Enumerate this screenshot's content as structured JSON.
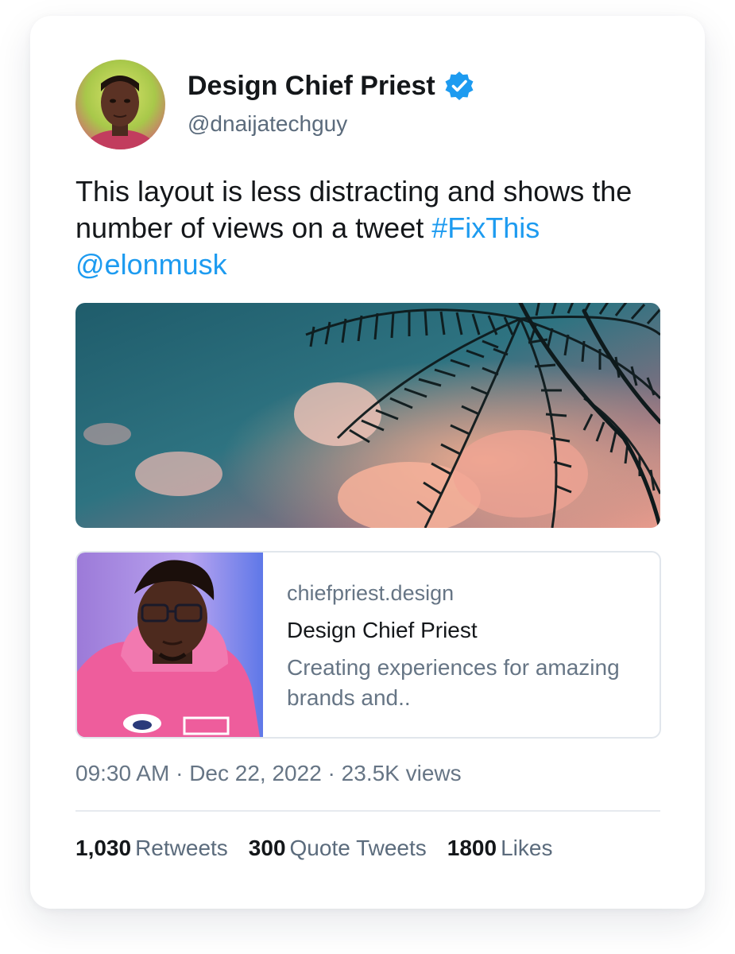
{
  "tweet": {
    "author": {
      "display_name": "Design Chief Priest",
      "handle": "@dnaijatechguy",
      "verified_icon": "verified-badge-icon",
      "avatar": "author-avatar"
    },
    "text": {
      "body": "This layout is less distracting and shows the number of views on a tweet ",
      "hashtag": "#FixThis",
      "mention": "@elonmusk"
    },
    "media": {
      "description_icon": "palm-trees-sky-photo"
    },
    "link_card": {
      "domain": "chiefpriest.design",
      "title": "Design Chief Priest",
      "description": "Creating experiences for amazing brands and..",
      "thumbnail": "link-card-thumbnail"
    },
    "meta": {
      "time": "09:30 AM",
      "separator": " · ",
      "date": "Dec 22, 2022",
      "views": "23.5K views"
    },
    "stats": [
      {
        "count": "1,030",
        "label": "Retweets"
      },
      {
        "count": "300",
        "label": "Quote Tweets"
      },
      {
        "count": "1800",
        "label": "Likes"
      }
    ]
  },
  "colors": {
    "link": "#1d9bf0",
    "verified": "#1d9bf0",
    "text_primary": "#14171a",
    "text_secondary": "#667585"
  }
}
